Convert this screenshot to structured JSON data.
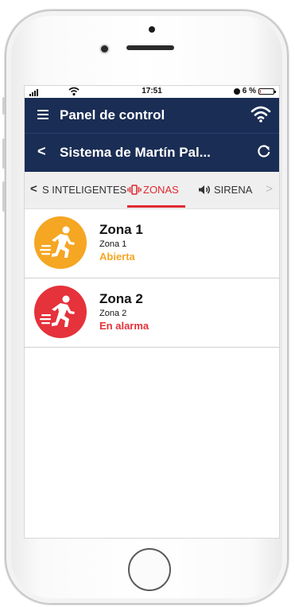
{
  "status_bar": {
    "time": "17:51",
    "battery": "6 %",
    "battery_level": 0.06
  },
  "app_bar": {
    "title": "Panel de control",
    "menu_icon": "hamburger-icon",
    "connection_icon": "wifi-icon"
  },
  "sub_bar": {
    "back_label": "<",
    "title": "Sistema de Martín Pal...",
    "refresh_icon": "refresh-icon"
  },
  "tabs": {
    "items": [
      {
        "label": "S INTELIGENTES",
        "active": false
      },
      {
        "label": "ZONAS",
        "active": true,
        "icon": "vibration-icon"
      },
      {
        "label": "SIRENA",
        "active": false,
        "icon": "speaker-icon"
      }
    ],
    "prev_label": "<",
    "next_label": ">",
    "accent_color": "#e02a32"
  },
  "zones": [
    {
      "name": "Zona 1",
      "subtitle": "Zona 1",
      "status": "Abierta",
      "color": "#f5a623",
      "icon": "running-person-icon"
    },
    {
      "name": "Zona 2",
      "subtitle": "Zona 2",
      "status": "En alarma",
      "color": "#e5323b",
      "icon": "running-person-icon"
    }
  ],
  "colors": {
    "header_bg": "#1a2d54"
  }
}
